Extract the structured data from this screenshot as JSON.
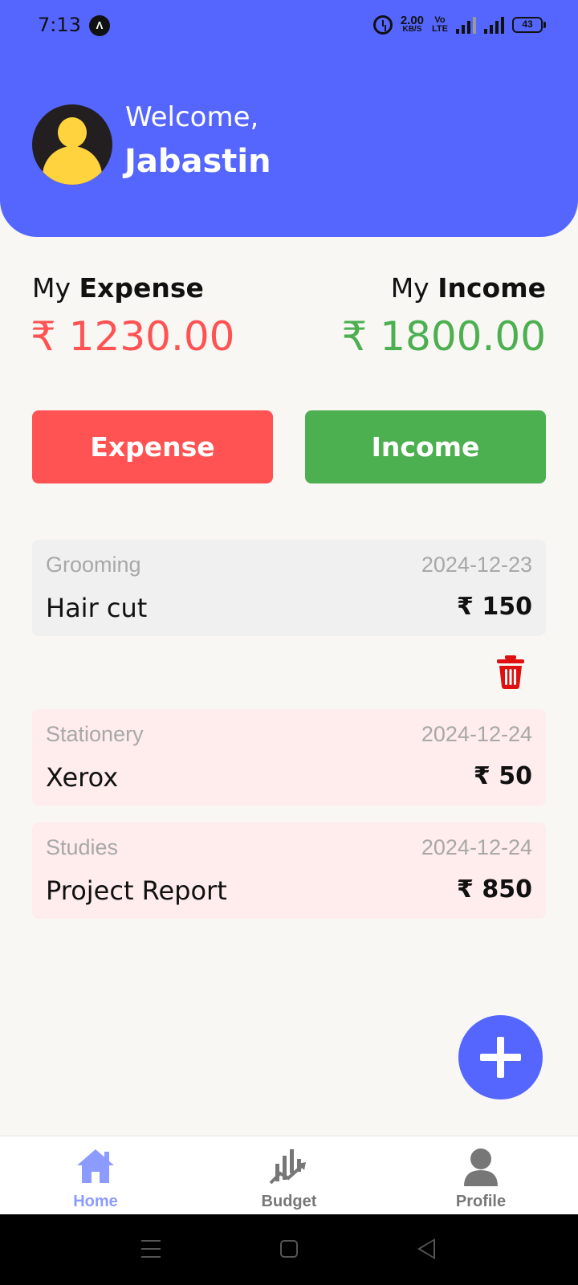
{
  "status_bar": {
    "time": "7:13",
    "app_icon": "Λ",
    "net_speed_value": "2.00",
    "net_speed_unit": "KB/S",
    "volte": "Vo\nLTE",
    "network": "4G",
    "battery": "43"
  },
  "header": {
    "welcome": "Welcome,",
    "user_name": "Jabastin"
  },
  "summary": {
    "expense_prefix": "My",
    "expense_word": "Expense",
    "expense_value": "₹ 1230.00",
    "income_prefix": "My",
    "income_word": "Income",
    "income_value": "₹ 1800.00"
  },
  "actions": {
    "expense_label": "Expense",
    "income_label": "Income"
  },
  "transactions": [
    {
      "category": "Grooming",
      "date": "2024-12-23",
      "title": "Hair cut",
      "amount": "₹ 150"
    },
    {
      "category": "Stationery",
      "date": "2024-12-24",
      "title": "Xerox",
      "amount": "₹ 50"
    },
    {
      "category": "Studies",
      "date": "2024-12-24",
      "title": "Project Report",
      "amount": "₹ 850"
    }
  ],
  "bottom_nav": {
    "home": "Home",
    "budget": "Budget",
    "profile": "Profile"
  },
  "colors": {
    "primary": "#5566ff",
    "expense": "#ff5252",
    "income": "#4caf50",
    "delete": "#e01010",
    "nav_active": "#8c9bff"
  }
}
